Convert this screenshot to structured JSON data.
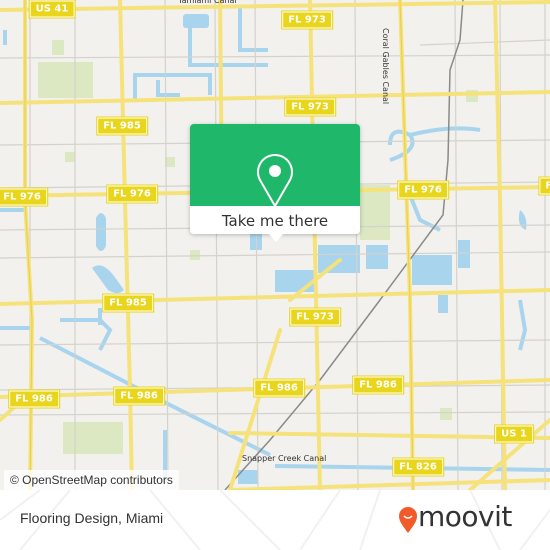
{
  "map": {
    "route_shields": [
      {
        "id": "us41",
        "label": "US 41"
      },
      {
        "id": "fl973-top-1",
        "label": "FL 973"
      },
      {
        "id": "fl985-top",
        "label": "FL 985"
      },
      {
        "id": "fl973-top-2",
        "label": "FL 973"
      },
      {
        "id": "fl976-left",
        "label": "FL 976"
      },
      {
        "id": "fl976-mid",
        "label": "FL 976"
      },
      {
        "id": "fl976-right",
        "label": "FL 976"
      },
      {
        "id": "fl976-edge",
        "label": "FL"
      },
      {
        "id": "fl985-mid",
        "label": "FL 985"
      },
      {
        "id": "fl973-mid",
        "label": "FL 973"
      },
      {
        "id": "fl986-left",
        "label": "FL 986"
      },
      {
        "id": "fl986-mid",
        "label": "FL 986"
      },
      {
        "id": "fl986-center",
        "label": "FL 986"
      },
      {
        "id": "fl986-right",
        "label": "FL 986"
      },
      {
        "id": "us1",
        "label": "US 1"
      },
      {
        "id": "fl826",
        "label": "FL 826"
      }
    ],
    "labels": {
      "tamiami_canal": "Tamiami Canal",
      "coral_gables_canal": "Coral Gables Canal",
      "snapper_creek_canal": "Snapper Creek Canal"
    },
    "colors": {
      "background": "#f2f1ed",
      "road_major": "#f6e27a",
      "road_minor": "#d4d2cc",
      "water": "#a8d4ee",
      "park": "#dbe8c2",
      "popup_green": "#1fb86b",
      "moovit_orange": "#f15a29"
    }
  },
  "popup": {
    "icon": "location-pin-icon",
    "button_label": "Take me there"
  },
  "attribution": "© OpenStreetMap contributors",
  "footer": {
    "place_title": "Flooring Design, Miami",
    "logo_text": "moovit"
  }
}
